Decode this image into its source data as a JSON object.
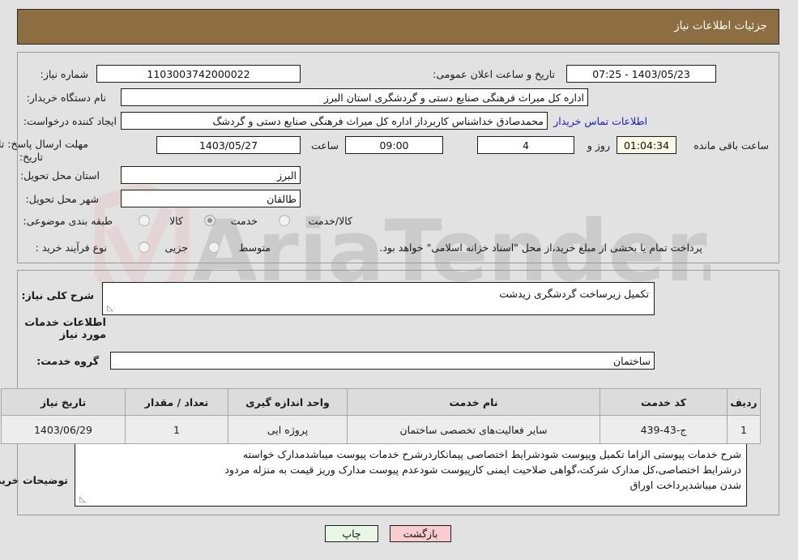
{
  "header": {
    "title": "جزئیات اطلاعات نیاز",
    "bar_color": "#8d6e41"
  },
  "form": {
    "need_number": {
      "label": "شماره نیاز:",
      "value": "1103003742000022"
    },
    "announce_datetime": {
      "label": "تاریخ و ساعت اعلان عمومی:",
      "value": "1403/05/23 - 07:25"
    },
    "buyer_org": {
      "label": "نام دستگاه خریدار:",
      "value": "اداره کل میراث فرهنگی  صنایع دستی و گردشگری استان البرز"
    },
    "request_creator": {
      "label": "ایجاد کننده درخواست:",
      "value": "محمدصادق خداشناس  کاربرداز اداره کل میراث فرهنگی  صنایع دستی و گردشگ",
      "contact_link": "اطلاعات تماس خریدار"
    },
    "response_deadline": {
      "label_line1": "مهلت ارسال پاسخ: تا",
      "label_line2": "تاریخ:",
      "date": "1403/05/27",
      "time_label": "ساعت",
      "time": "09:00",
      "days": "4",
      "days_label": "روز و",
      "countdown": "01:04:34",
      "countdown_label": "ساعت باقی مانده"
    },
    "delivery_province": {
      "label": "استان محل تحویل:",
      "value": "البرز"
    },
    "delivery_city": {
      "label": "شهر محل تحویل:",
      "value": "طالقان"
    },
    "subject_category": {
      "label": "طبقه بندی موضوعی:",
      "options": [
        "کالا",
        "خدمت",
        "کالا/خدمت"
      ],
      "selected": "خدمت"
    },
    "purchase_process": {
      "label": "نوع فرآیند خرید :",
      "options": [
        "جزیی",
        "متوسط"
      ],
      "selected": "",
      "note": "پرداخت تمام یا بخشی از مبلغ خرید،از محل \"اسناد خزانه اسلامی\" خواهد بود."
    },
    "general_description": {
      "label": "شرح کلی نیاز:",
      "value": "تکمیل زیرساخت گردشگری زیدشت"
    },
    "services_section_title": "اطلاعات خدمات مورد نیاز",
    "service_group": {
      "label": "گروه خدمت:",
      "value": "ساختمان"
    },
    "buyer_notes": {
      "label": "توضیحات خریدار:",
      "line1": "شرح خدمات پیوستی الزاما تکمیل وپیوست شودشرایط اختصاصی پیمانکاردرشرح خدمات پیوست میباشدمدارک خواسته",
      "line2": "درشرایط اختصاصی،کل مدارک شرکت،گواهی صلاحیت ایمنی کارپیوست شودعدم پیوست مدارک وریز قیمت به منزله مردود",
      "line3": "شدن میباشدپرداخت اوراق"
    }
  },
  "table": {
    "columns": [
      "ردیف",
      "کد خدمت",
      "نام خدمت",
      "واحد اندازه گیری",
      "تعداد / مقدار",
      "تاریخ نیاز"
    ],
    "rows": [
      {
        "row_no": "1",
        "service_code": "ج-43-439",
        "service_name": "سایر فعالیت‌های تخصصی ساختمان",
        "unit": "پروژه ایی",
        "quantity": "1",
        "need_date": "1403/06/29"
      }
    ]
  },
  "footer": {
    "print_label": "چاپ",
    "back_label": "بازگشت"
  },
  "watermark": {
    "text": "AriaTender.net"
  }
}
